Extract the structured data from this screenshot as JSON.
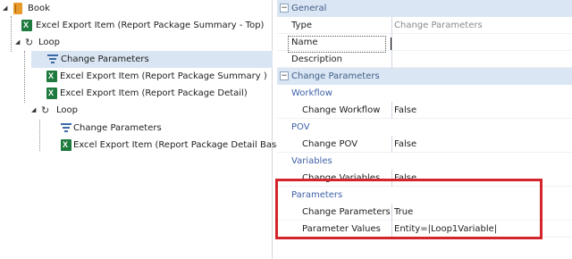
{
  "tree": {
    "items": [
      {
        "label": "Book",
        "icon": "book-icon"
      },
      {
        "label": "Excel Export Item (Report Package Summary - Top)",
        "icon": "excel-icon"
      },
      {
        "label": "Loop",
        "icon": "loop-icon"
      },
      {
        "label": "Change Parameters",
        "icon": "filter-icon"
      },
      {
        "label": "Excel Export Item (Report Package Summary )",
        "icon": "excel-icon"
      },
      {
        "label": "Excel Export Item (Report Package Detail)",
        "icon": "excel-icon"
      },
      {
        "label": "Loop",
        "icon": "loop-icon"
      },
      {
        "label": "Change Parameters",
        "icon": "filter-icon"
      },
      {
        "label": "Excel Export Item (Report Package Detail Base)",
        "icon": "excel-icon"
      }
    ]
  },
  "props": {
    "general": {
      "title": "General",
      "toggle": "⊟"
    },
    "type": {
      "key": "Type",
      "value": "Change Parameters"
    },
    "name": {
      "key": "Name",
      "value": ""
    },
    "description": {
      "key": "Description",
      "value": ""
    },
    "change_params_cat": {
      "title": "Change Parameters",
      "toggle": "⊟"
    },
    "workflow": {
      "title": "Workflow"
    },
    "change_workflow": {
      "key": "Change Workflow",
      "value": "False"
    },
    "pov": {
      "title": "POV"
    },
    "change_pov": {
      "key": "Change POV",
      "value": "False"
    },
    "variables": {
      "title": "Variables"
    },
    "change_variables": {
      "key": "Change Variables",
      "value": "False"
    },
    "parameters": {
      "title": "Parameters"
    },
    "change_parameters": {
      "key": "Change Parameters",
      "value": "True"
    },
    "parameter_values": {
      "key": "Parameter Values",
      "value": "Entity=|Loop1Variable|"
    }
  },
  "colors": {
    "highlight": "#d4252c",
    "category": "#dbe6f4",
    "selection": "#d9e5f3"
  }
}
